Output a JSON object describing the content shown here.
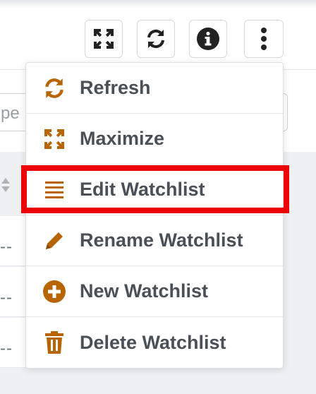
{
  "colors": {
    "accent": "#b86400",
    "icon_dark": "#222222",
    "highlight": "#ee0000"
  },
  "toolbar": {
    "buttons": [
      {
        "name": "maximize-button",
        "icon": "maximize-icon"
      },
      {
        "name": "refresh-button",
        "icon": "refresh-icon"
      },
      {
        "name": "info-button",
        "icon": "info-icon"
      },
      {
        "name": "more-options-button",
        "icon": "vertical-dots-icon"
      }
    ]
  },
  "search": {
    "placeholder_partial": "pe"
  },
  "list": {
    "row_text": [
      "--",
      "--",
      "--"
    ]
  },
  "menu": {
    "items": [
      {
        "label": "Refresh",
        "icon": "refresh-icon"
      },
      {
        "label": "Maximize",
        "icon": "maximize-icon"
      },
      {
        "label": "Edit Watchlist",
        "icon": "list-lines-icon",
        "highlighted": true
      },
      {
        "label": "Rename Watchlist",
        "icon": "pencil-icon"
      },
      {
        "label": "New Watchlist",
        "icon": "plus-circle-icon"
      },
      {
        "label": "Delete Watchlist",
        "icon": "trash-icon"
      }
    ]
  }
}
